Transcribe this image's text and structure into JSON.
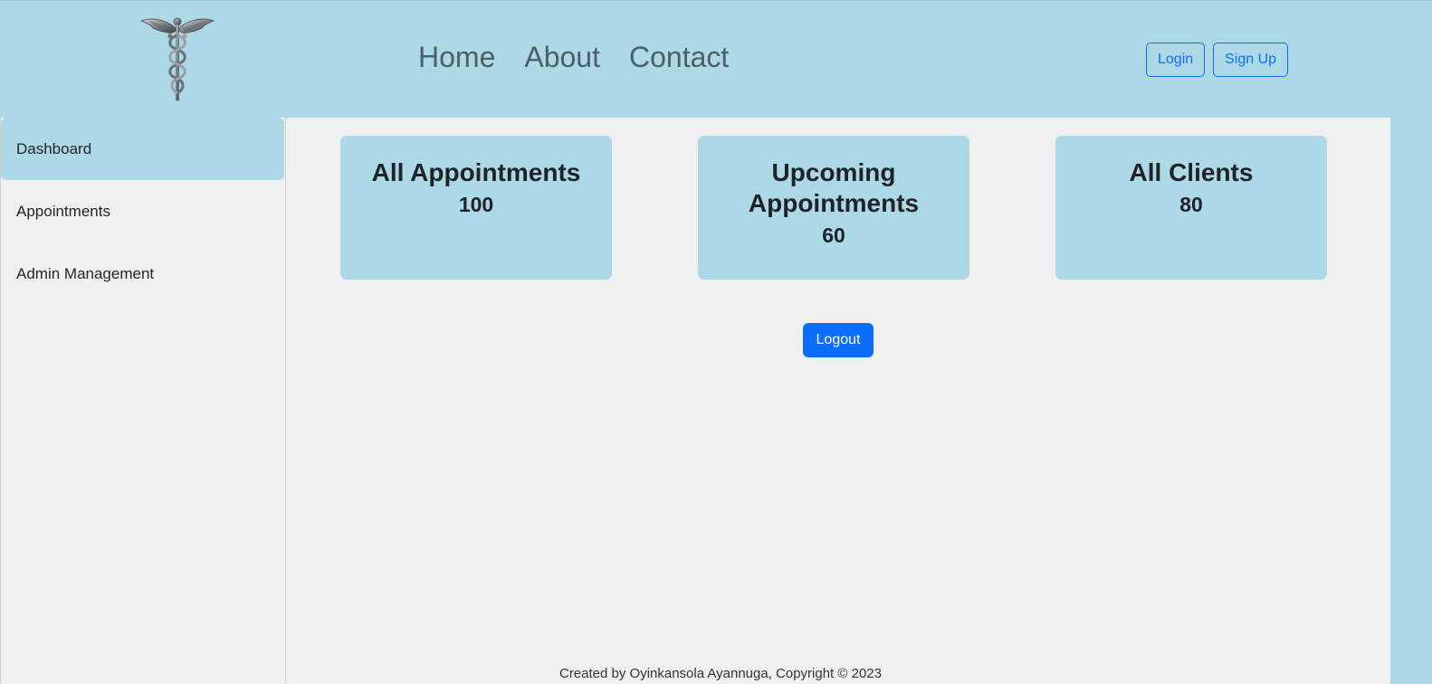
{
  "header": {
    "logo_icon": "caduceus-icon",
    "nav": [
      "Home",
      "About",
      "Contact"
    ],
    "login_label": "Login",
    "signup_label": "Sign Up"
  },
  "sidebar": {
    "items": [
      {
        "label": "Dashboard",
        "active": true
      },
      {
        "label": "Appointments",
        "active": false
      },
      {
        "label": "Admin Management",
        "active": false
      }
    ]
  },
  "cards": [
    {
      "title": "All Appointments",
      "value": "100"
    },
    {
      "title": "Upcoming Appointments",
      "value": "60"
    },
    {
      "title": "All Clients",
      "value": "80"
    }
  ],
  "logout_label": "Logout",
  "footer": {
    "text": "Created by Oyinkansola Ayannuga, Copyright © 2023"
  },
  "colors": {
    "background": "#add8e6",
    "content": "#f0f0f0",
    "primary": "#0d6efd",
    "nav_text": "#4a5f68"
  }
}
